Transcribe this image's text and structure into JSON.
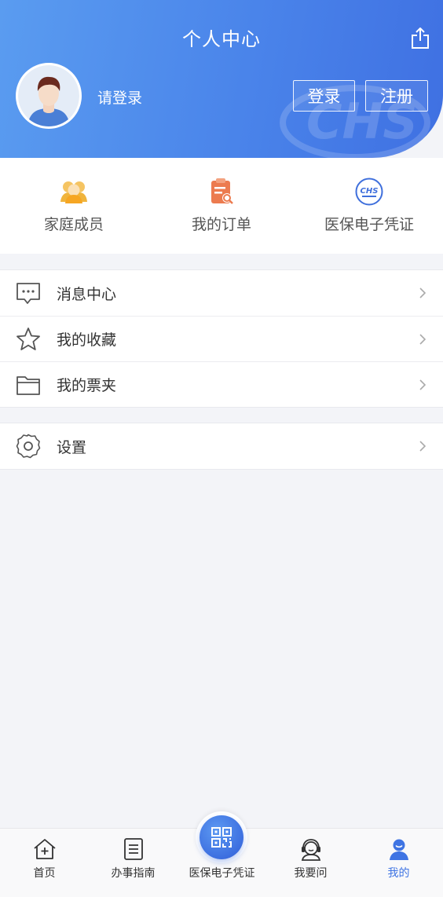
{
  "header": {
    "title": "个人中心",
    "login_hint": "请登录",
    "login_button": "登录",
    "register_button": "注册",
    "share_icon": "share-icon",
    "avatar_icon": "user-avatar",
    "watermark_text": "CHS"
  },
  "quick_entries": [
    {
      "label": "家庭成员",
      "icon": "family-members-icon",
      "color": "#f0b43c"
    },
    {
      "label": "我的订单",
      "icon": "order-clipboard-icon",
      "color": "#ec7b4f"
    },
    {
      "label": "医保电子凭证",
      "icon": "chs-logo-icon",
      "color": "#3f6fdc"
    }
  ],
  "menu_group_1": [
    {
      "label": "消息中心",
      "icon": "message-bubble-icon"
    },
    {
      "label": "我的收藏",
      "icon": "star-icon"
    },
    {
      "label": "我的票夹",
      "icon": "folder-icon"
    }
  ],
  "menu_group_2": [
    {
      "label": "设置",
      "icon": "gear-icon"
    }
  ],
  "tabbar": {
    "items": [
      {
        "label": "首页",
        "icon": "home-icon"
      },
      {
        "label": "办事指南",
        "icon": "guide-list-icon"
      },
      {
        "label": "医保电子凭证",
        "icon": "qr-code-icon"
      },
      {
        "label": "我要问",
        "icon": "customer-service-icon"
      },
      {
        "label": "我的",
        "icon": "profile-icon"
      }
    ],
    "active_index": 4,
    "active_color": "#3f74e3"
  },
  "colors": {
    "header_gradient_start": "#5a9cf0",
    "header_gradient_end": "#3f70e2",
    "background": "#f3f4f8"
  }
}
